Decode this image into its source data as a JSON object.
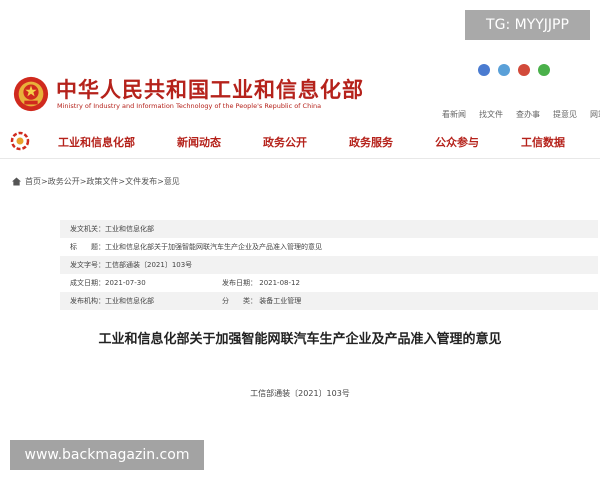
{
  "watermarks": {
    "top": "TG: MYYJJPP",
    "bottom": "www.backmagazin.com"
  },
  "header": {
    "title": "中华人民共和国工业和信息化部",
    "subtitle": "Ministry of Industry and Information Technology of the People's Republic of China",
    "utility_links": [
      "看新闻",
      "找文件",
      "查办事",
      "提意见",
      "网站群"
    ],
    "social_colors": [
      "#4a7bd0",
      "#5aa0d8",
      "#d24a3a",
      "#4ab04a"
    ]
  },
  "nav": {
    "items": [
      "工业和信息化部",
      "新闻动态",
      "政务公开",
      "政务服务",
      "公众参与",
      "工信数据"
    ]
  },
  "breadcrumb": [
    "首页",
    "政务公开",
    "政策文件",
    "文件发布",
    "意见"
  ],
  "breadcrumb_separator": " > ",
  "document": {
    "rows": [
      {
        "label": "发文机关：",
        "value": "工业和信息化部"
      },
      {
        "label": "标　　题：",
        "value": "工业和信息化部关于加强智能网联汽车生产企业及产品准入管理的意见"
      },
      {
        "label": "发文字号：",
        "value": "工信部通装〔2021〕103号"
      },
      {
        "label": "成文日期：",
        "value": "2021-07-30",
        "label2": "发布日期：",
        "value2": "2021-08-12"
      },
      {
        "label": "发布机构：",
        "value": "工业和信息化部",
        "label2": "分　　类：",
        "value2": "装备工业管理"
      }
    ],
    "title": "工业和信息化部关于加强智能网联汽车生产企业及产品准入管理的意见",
    "number": "工信部通装〔2021〕103号"
  },
  "colors": {
    "brand_red": "#b5221b",
    "row_shade": "#f2f2f2"
  }
}
